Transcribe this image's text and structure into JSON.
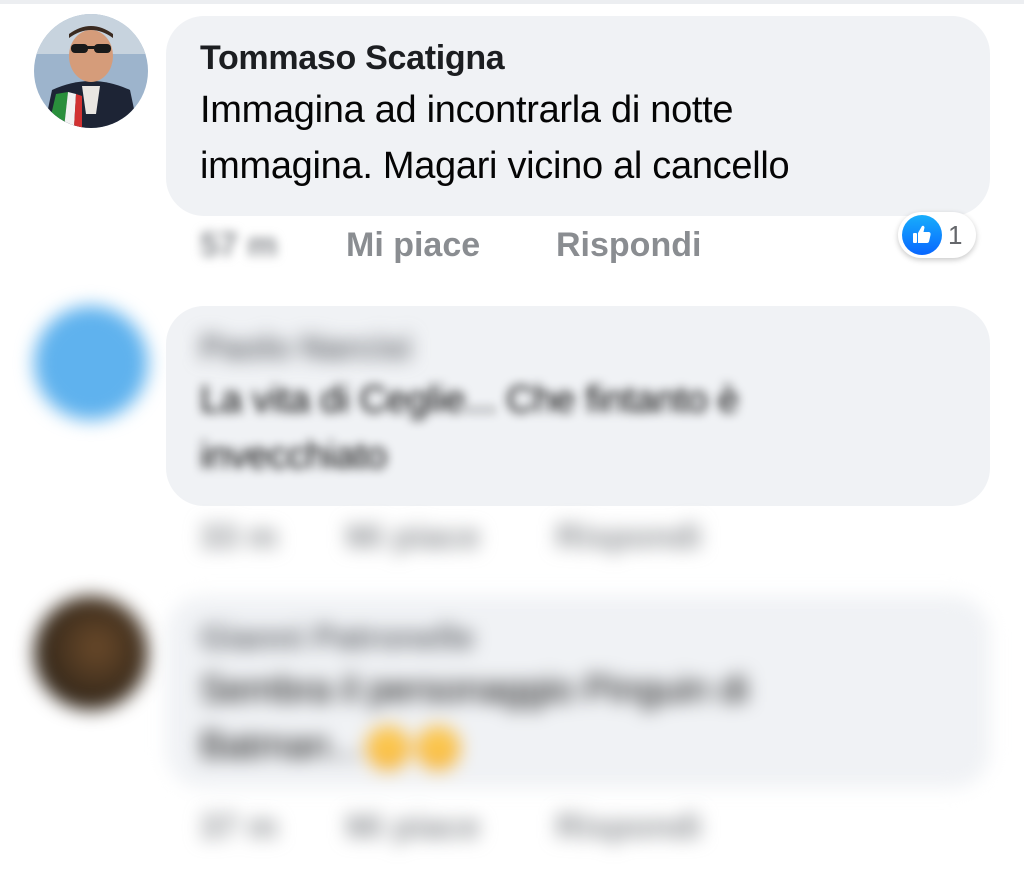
{
  "comments": [
    {
      "author": "Tommaso Scatigna",
      "text_line1": "Immagina ad incontrarla di notte",
      "text_line2": "immagina. Magari vicino al cancello",
      "time": "57 m",
      "like_label": "Mi piace",
      "reply_label": "Rispondi",
      "reaction_count": "1",
      "reaction_icon": "thumbs-up-icon",
      "reaction_color": "#0866ff"
    },
    {
      "author": "Paolo Narcisi",
      "text_line1": "La vita di Ceglie... Che fintanto è",
      "text_line2": "invecchiato",
      "time": "33 m",
      "like_label": "Mi piace",
      "reply_label": "Rispondi"
    },
    {
      "author": "Gianni Patronelle",
      "text_line1": "Sembra il personaggio Pinguin di",
      "text_line2": "Batman...",
      "time": "37 m",
      "like_label": "Mi piace",
      "reply_label": "Rispondi",
      "emoji_icon": "laughing-emoji-icon"
    }
  ]
}
